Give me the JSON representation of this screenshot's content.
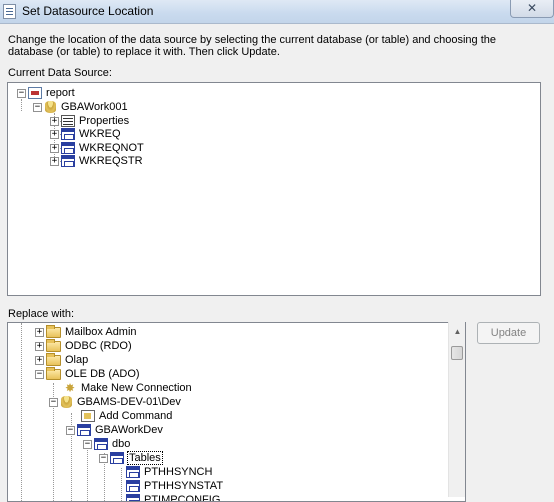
{
  "window": {
    "title": "Set Datasource Location",
    "close_label": "✕"
  },
  "description": "Change the location of the data source by selecting the current database (or table) and choosing the database (or table) to replace it with.  Then click Update.",
  "current_source": {
    "label": "Current Data Source:",
    "tree": {
      "report": "report",
      "database": "GBAWork001",
      "children": [
        "Properties",
        "WKREQ",
        "WKREQNOT",
        "WKREQSTR"
      ]
    }
  },
  "replace_with": {
    "label": "Replace with:",
    "update_label": "Update",
    "tree": {
      "mailbox_admin": "Mailbox Admin",
      "odbc": "ODBC (RDO)",
      "olap": "Olap",
      "oledb": "OLE DB (ADO)",
      "make_new_connection": "Make New Connection",
      "server": "GBAMS-DEV-01\\Dev",
      "add_command": "Add Command",
      "database": "GBAWorkDev",
      "schema": "dbo",
      "tables": "Tables",
      "table_items": [
        "PTHHSYNCH",
        "PTHHSYNSTAT",
        "PTIMPCONFIG"
      ]
    }
  },
  "glyphs": {
    "expand": "+",
    "collapse": "−",
    "scroll_up": "▲"
  }
}
